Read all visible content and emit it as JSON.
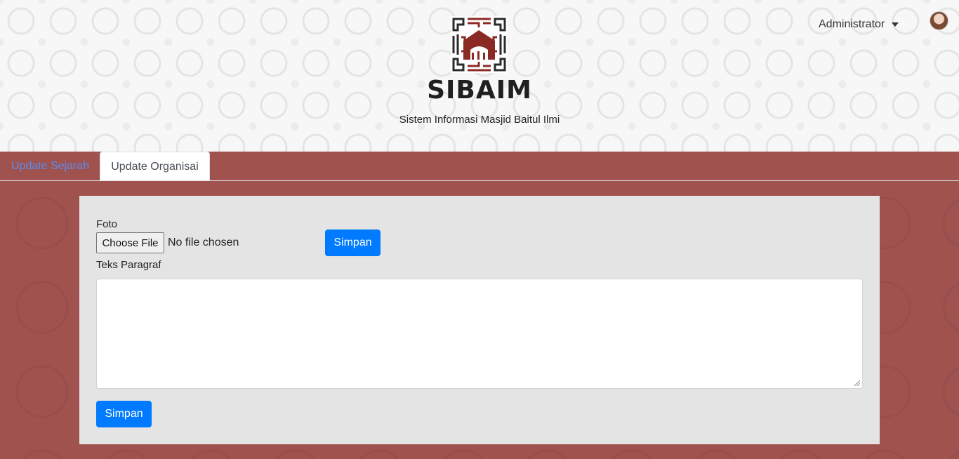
{
  "header": {
    "title": "SIBAIM",
    "subtitle": "Sistem Informasi Masjid Baitul Ilmi",
    "user_name": "Administrator",
    "logo_icon": "mosque-calligraphy-logo",
    "avatar_icon": "user-avatar"
  },
  "tabs": [
    {
      "label": "Update Sejarah",
      "active": false
    },
    {
      "label": "Update Organisai",
      "active": true
    }
  ],
  "form": {
    "foto_label": "Foto",
    "file_button_label": "Choose File",
    "file_status": "No file chosen",
    "save_foto_label": "Simpan",
    "teks_label": "Teks Paragraf",
    "teks_value": "",
    "save_teks_label": "Simpan"
  },
  "colors": {
    "brand_maroon": "#a0524f",
    "primary_button": "#007bff",
    "link_blue": "#5a8cf0",
    "card_bg": "#e4e4e4"
  }
}
